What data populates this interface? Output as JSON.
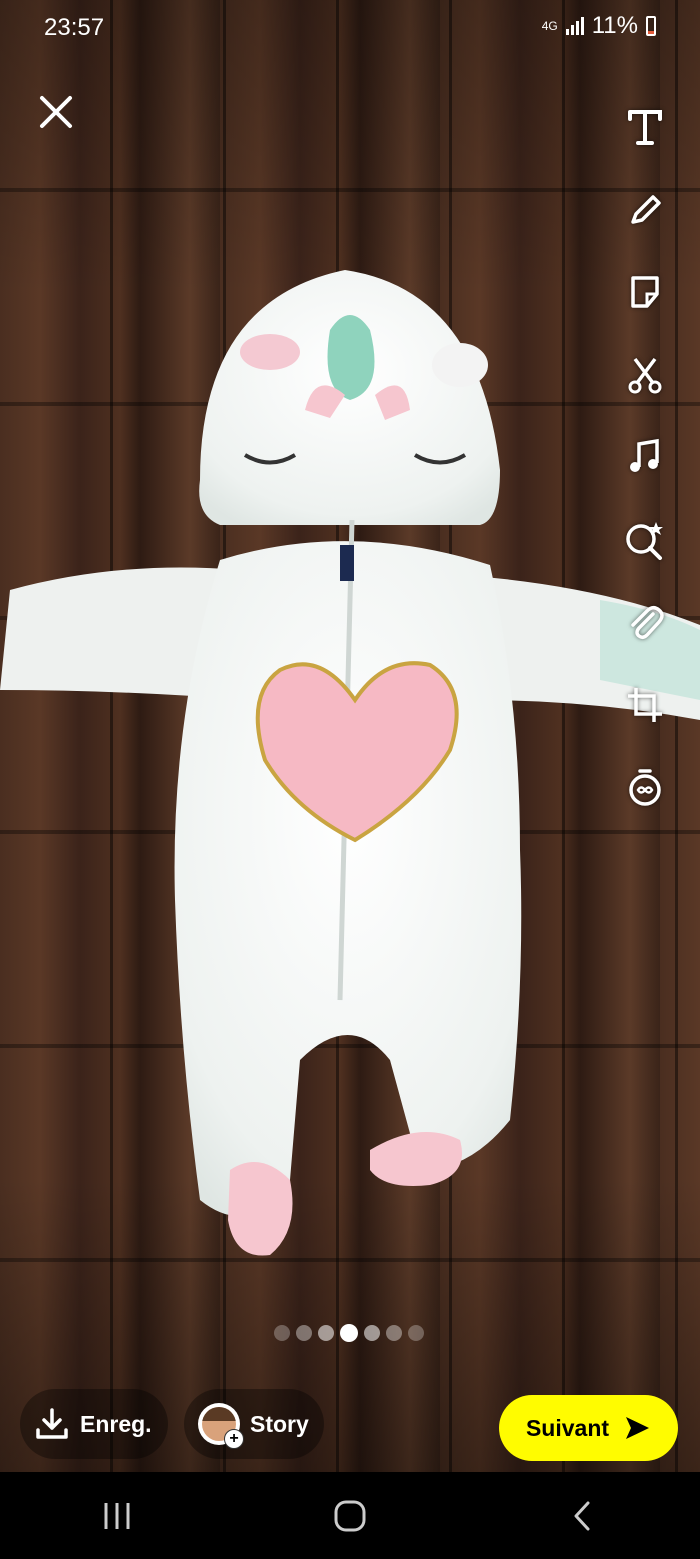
{
  "status_bar": {
    "time": "23:57",
    "network": "4G",
    "battery": "11%"
  },
  "toolbar": {
    "items": [
      {
        "icon": "text-icon"
      },
      {
        "icon": "pencil-icon"
      },
      {
        "icon": "sticker-icon"
      },
      {
        "icon": "scissors-icon"
      },
      {
        "icon": "music-note-icon"
      },
      {
        "icon": "lens-search-icon"
      },
      {
        "icon": "paperclip-icon"
      },
      {
        "icon": "crop-icon"
      },
      {
        "icon": "timer-icon"
      }
    ]
  },
  "pager": {
    "count": 7,
    "active_index": 3
  },
  "actions": {
    "save_label": "Enreg.",
    "story_label": "Story",
    "next_label": "Suivant"
  },
  "colors": {
    "accent": "#fffc00"
  }
}
